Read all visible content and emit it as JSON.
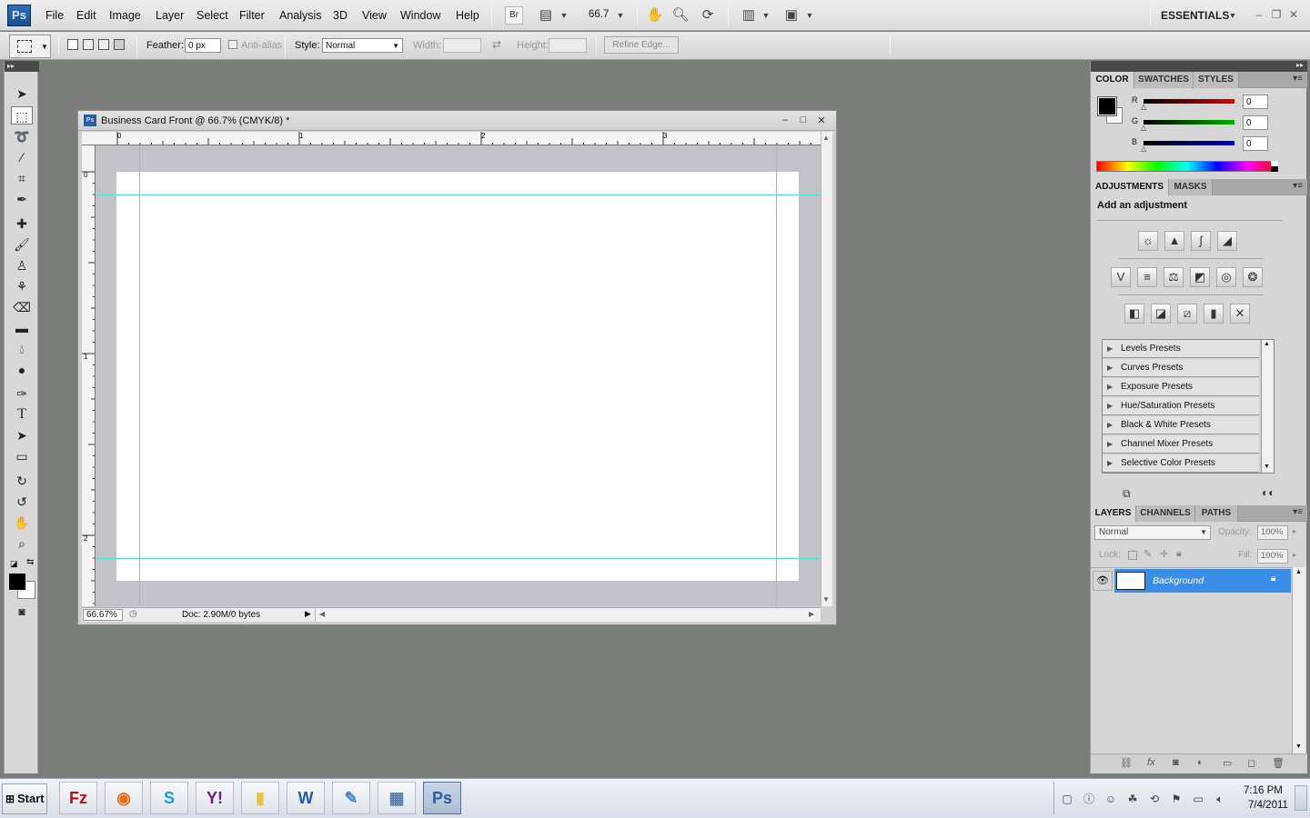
{
  "app": {
    "logo_text": "Ps",
    "workspace": "ESSENTIALS"
  },
  "menu": [
    "File",
    "Edit",
    "Image",
    "Layer",
    "Select",
    "Filter",
    "Analysis",
    "3D",
    "View",
    "Window",
    "Help"
  ],
  "menubar": {
    "bridge_label": "Br",
    "zoom_value": "66.7"
  },
  "options": {
    "feather_label": "Feather:",
    "feather_value": "0 px",
    "antialias_label": "Anti-alias",
    "style_label": "Style:",
    "style_value": "Normal",
    "width_label": "Width:",
    "height_label": "Height:",
    "refine_label": "Refine Edge..."
  },
  "document": {
    "title": "Business Card Front @ 66.7% (CMYK/8) *",
    "zoom": "66.67%",
    "doc_info": "Doc: 2.90M/0 bytes",
    "ruler_top_labels": [
      "0",
      "1",
      "2",
      "3"
    ],
    "ruler_left_labels": [
      "0",
      "1",
      "2"
    ]
  },
  "color_panel": {
    "tabs": [
      "COLOR",
      "SWATCHES",
      "STYLES"
    ],
    "channels": [
      {
        "name": "R",
        "value": "0",
        "color": "#e00000"
      },
      {
        "name": "G",
        "value": "0",
        "color": "#00b000"
      },
      {
        "name": "B",
        "value": "0",
        "color": "#0000d0"
      }
    ],
    "foreground": "#000000",
    "background": "#ffffff"
  },
  "adjustments_panel": {
    "tabs": [
      "ADJUSTMENTS",
      "MASKS"
    ],
    "heading": "Add an adjustment",
    "presets": [
      "Levels Presets",
      "Curves Presets",
      "Exposure Presets",
      "Hue/Saturation Presets",
      "Black & White Presets",
      "Channel Mixer Presets",
      "Selective Color Presets"
    ]
  },
  "layers_panel": {
    "tabs": [
      "LAYERS",
      "CHANNELS",
      "PATHS"
    ],
    "blend_mode": "Normal",
    "opacity_label": "Opacity:",
    "opacity_value": "100%",
    "lock_label": "Lock:",
    "fill_label": "Fill:",
    "fill_value": "100%",
    "layers": [
      {
        "name": "Background",
        "selected": true
      }
    ],
    "selection_color": "#3a8ee6"
  },
  "taskbar": {
    "start_label": "Start",
    "apps": [
      {
        "icon": "filezilla-icon",
        "glyph": "Fz",
        "color": "#c0111b"
      },
      {
        "icon": "firefox-icon",
        "glyph": "◉",
        "color": "#e5701d"
      },
      {
        "icon": "skype-icon",
        "glyph": "S",
        "color": "#1a9be0"
      },
      {
        "icon": "yahoo-messenger-icon",
        "glyph": "Y!",
        "color": "#6a1b9a"
      },
      {
        "icon": "folder-icon",
        "glyph": "▮",
        "color": "#e8c34a"
      },
      {
        "icon": "word-icon",
        "glyph": "W",
        "color": "#1f5bb5"
      },
      {
        "icon": "paint-icon",
        "glyph": "✎",
        "color": "#4a88c8"
      },
      {
        "icon": "calculator-icon",
        "glyph": "▦",
        "color": "#5a7aa8"
      },
      {
        "icon": "photoshop-icon",
        "glyph": "Ps",
        "color": "#2a5c9a"
      }
    ],
    "time": "7:16 PM",
    "date": "7/4/2011"
  }
}
